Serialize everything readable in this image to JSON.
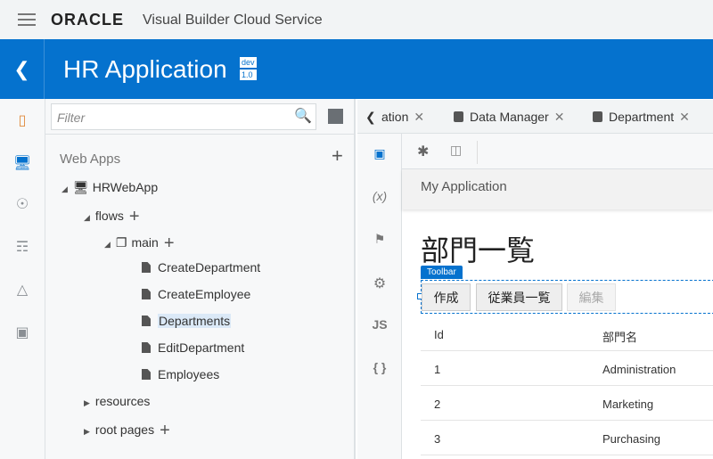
{
  "header": {
    "logo": "ORACLE",
    "service": "Visual Builder Cloud Service"
  },
  "app": {
    "title": "HR Application",
    "badge_env": "dev",
    "badge_version": "1.0"
  },
  "filter": {
    "placeholder": "Filter"
  },
  "tree": {
    "section": "Web Apps",
    "app": "HRWebApp",
    "flows": "flows",
    "main": "main",
    "pages": [
      "CreateDepartment",
      "CreateEmployee",
      "Departments",
      "EditDepartment",
      "Employees"
    ],
    "selected": "Departments",
    "resources": "resources",
    "root_pages": "root pages"
  },
  "tabs": [
    {
      "label": "ation"
    },
    {
      "label": "Data Manager"
    },
    {
      "label": "Department"
    }
  ],
  "designer": {
    "header": "My Application",
    "page_title": "部門一覧",
    "toolbar_label": "Toolbar",
    "buttons": [
      {
        "label": "作成",
        "disabled": false
      },
      {
        "label": "従業員一覧",
        "disabled": false
      },
      {
        "label": "編集",
        "disabled": true
      }
    ],
    "table": {
      "columns": [
        "Id",
        "部門名"
      ],
      "rows": [
        [
          "1",
          "Administration"
        ],
        [
          "2",
          "Marketing"
        ],
        [
          "3",
          "Purchasing"
        ]
      ]
    }
  },
  "icons": {
    "x": "(x)",
    "js": "JS",
    "braces": "{ }"
  },
  "colors": {
    "brand": "#0572ce"
  }
}
